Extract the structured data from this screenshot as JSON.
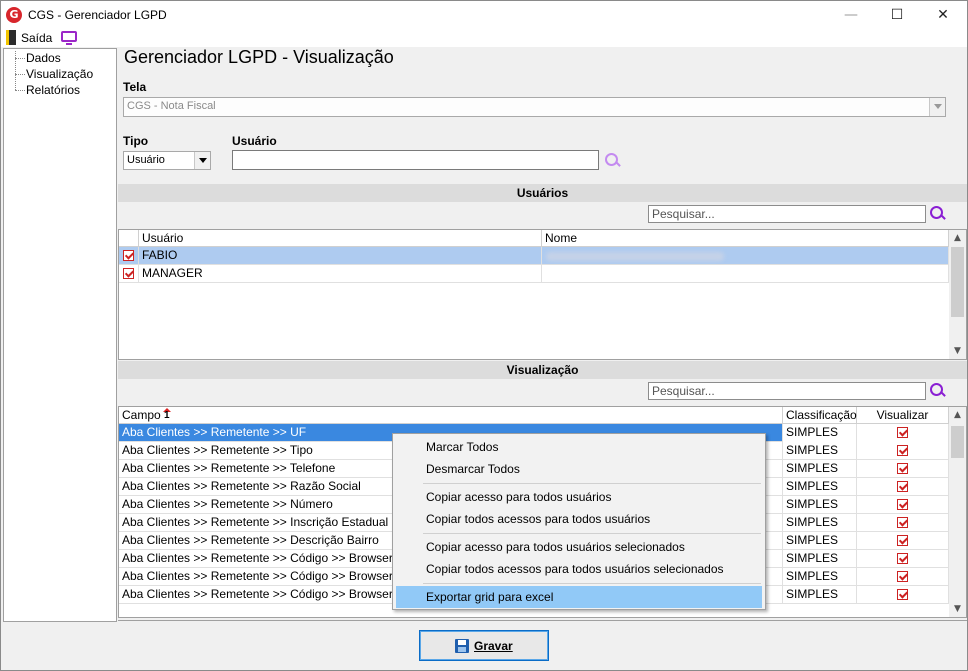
{
  "window": {
    "title": "CGS - Gerenciador LGPD",
    "logo_letter": "G",
    "min_glyph": "—",
    "max_glyph": "☐",
    "close_glyph": "✕"
  },
  "menubar": {
    "exit_label": "Saída"
  },
  "tree": {
    "items": [
      {
        "label": "Dados"
      },
      {
        "label": "Visualização"
      },
      {
        "label": "Relatórios"
      }
    ]
  },
  "main": {
    "title": "Gerenciador LGPD - Visualização",
    "tela_label": "Tela",
    "tela_value": "CGS - Nota Fiscal",
    "tipo_label": "Tipo",
    "tipo_value": "Usuário",
    "usuario_label": "Usuário",
    "usuario_value": ""
  },
  "usuarios_section": {
    "header": "Usuários",
    "search_placeholder": "Pesquisar...",
    "columns": [
      "Usuário",
      "Nome"
    ],
    "rows": [
      {
        "usuario": "FABIO",
        "nome": ""
      },
      {
        "usuario": "MANAGER",
        "nome": ""
      }
    ]
  },
  "visualizacao_section": {
    "header": "Visualização",
    "search_placeholder": "Pesquisar...",
    "columns": [
      "Campo",
      "Classificação",
      "Visualizar"
    ],
    "rows": [
      {
        "campo": "Aba Clientes >> Remetente >> UF",
        "classificacao": "SIMPLES"
      },
      {
        "campo": "Aba Clientes >> Remetente >> Tipo",
        "classificacao": "SIMPLES"
      },
      {
        "campo": "Aba Clientes >> Remetente >> Telefone",
        "classificacao": "SIMPLES"
      },
      {
        "campo": "Aba Clientes >> Remetente >> Razão Social",
        "classificacao": "SIMPLES"
      },
      {
        "campo": "Aba Clientes >> Remetente >> Número",
        "classificacao": "SIMPLES"
      },
      {
        "campo": "Aba Clientes >> Remetente >> Inscrição Estadual",
        "classificacao": "SIMPLES"
      },
      {
        "campo": "Aba Clientes >> Remetente >> Descrição Bairro",
        "classificacao": "SIMPLES"
      },
      {
        "campo": "Aba Clientes >> Remetente >> Código >> Browser de pes",
        "classificacao": "SIMPLES"
      },
      {
        "campo": "Aba Clientes >> Remetente >> Código >> Browser de pes",
        "classificacao": "SIMPLES"
      },
      {
        "campo": "Aba Clientes >> Remetente >> Código >> Browser de pes",
        "classificacao": "SIMPLES"
      }
    ]
  },
  "context_menu": {
    "items": [
      "Marcar Todos",
      "Desmarcar Todos",
      "Copiar acesso para todos usuários",
      "Copiar todos acessos para todos usuários",
      "Copiar acesso para todos usuários selecionados",
      "Copiar todos acessos para todos usuários selecionados",
      "Exportar grid para excel"
    ]
  },
  "footer": {
    "save_label": "Gravar"
  },
  "colors": {
    "accent": "#8a1fd3",
    "selection": "#3a88e0",
    "menu_highlight": "#91c9f7"
  }
}
